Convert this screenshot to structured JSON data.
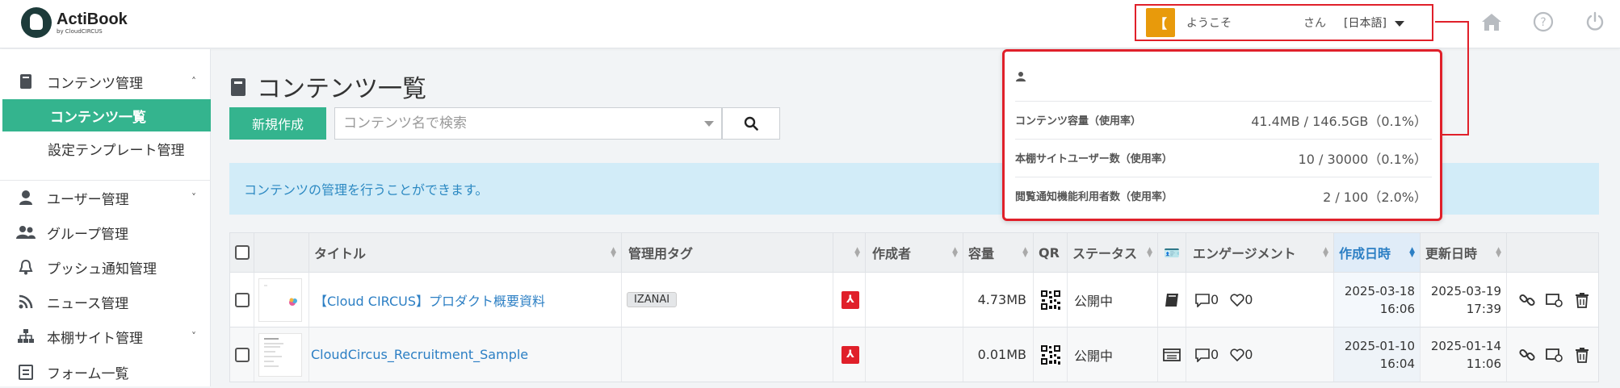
{
  "header": {
    "logo_title": "ActiBook",
    "logo_sub": "by CloudCIRCUS",
    "user_badge": "【",
    "welcome": "ようこそ",
    "san": "さん",
    "language": "[日本語]",
    "icons": [
      "home-icon",
      "help-icon",
      "power-icon"
    ],
    "accent": "#e89a0b",
    "highlight": "#e0202a"
  },
  "sidebar": {
    "sections": [
      {
        "label": "コンテンツ管理",
        "icon": "book-icon",
        "chevron": "^"
      },
      {
        "label": "ユーザー管理",
        "icon": "user-icon",
        "chevron": "v"
      },
      {
        "label": "グループ管理",
        "icon": "group-icon"
      },
      {
        "label": "プッシュ通知管理",
        "icon": "bell-icon"
      },
      {
        "label": "ニュース管理",
        "icon": "rss-icon"
      },
      {
        "label": "本棚サイト管理",
        "icon": "sitemap-icon",
        "chevron": "v"
      },
      {
        "label": "フォーム一覧",
        "icon": "form-icon"
      }
    ],
    "sub_items": [
      {
        "label": "コンテンツ一覧",
        "active": true
      },
      {
        "label": "設定テンプレート管理",
        "active": false
      }
    ],
    "active_color": "#34b48e"
  },
  "main": {
    "page_title": "コンテンツ一覧",
    "new_button": "新規作成",
    "search_placeholder": "コンテンツ名で検索",
    "info": "コンテンツの管理を行うことができます。",
    "columns": [
      "タイトル",
      "管理用タグ",
      "作成者",
      "容量",
      "QR",
      "ステータス",
      "エンゲージメント",
      "作成日時",
      "更新日時"
    ],
    "rows": [
      {
        "title": "【Cloud CIRCUS】プロダクト概要資料",
        "tag": "IZANAI",
        "size": "4.73MB",
        "status": "公開中",
        "comments": "0",
        "likes": "0",
        "created_date": "2025-03-18",
        "created_time": "16:06",
        "updated_date": "2025-03-19",
        "updated_time": "17:39"
      },
      {
        "title": "CloudCircus_Recruitment_Sample",
        "tag": "",
        "size": "0.01MB",
        "status": "公開中",
        "comments": "0",
        "likes": "0",
        "created_date": "2025-01-10",
        "created_time": "16:04",
        "updated_date": "2025-01-14",
        "updated_time": "11:06"
      }
    ]
  },
  "popup": {
    "rows": [
      {
        "label": "コンテンツ容量（使用率）",
        "value": "41.4MB / 146.5GB（0.1%）"
      },
      {
        "label": "本棚サイトユーザー数（使用率）",
        "value": "10 / 30000（0.1%）"
      },
      {
        "label": "閲覧通知機能利用者数（使用率）",
        "value": "2 / 100（2.0%）"
      }
    ]
  }
}
